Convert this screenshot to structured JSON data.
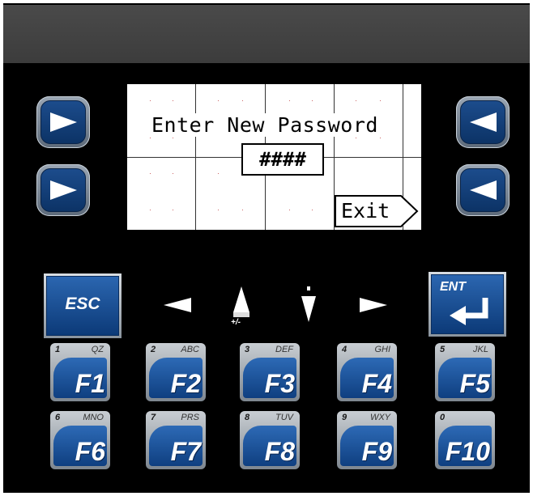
{
  "screen": {
    "title": "Enter New Password",
    "password_value": "####",
    "exit_label": "Exit"
  },
  "keys": {
    "esc_label": "ESC",
    "ent_label": "ENT",
    "plus_minus": "+/-",
    "function_keys": [
      {
        "label": "F1",
        "num": "1",
        "letters": "QZ"
      },
      {
        "label": "F2",
        "num": "2",
        "letters": "ABC"
      },
      {
        "label": "F3",
        "num": "3",
        "letters": "DEF"
      },
      {
        "label": "F4",
        "num": "4",
        "letters": "GHI"
      },
      {
        "label": "F5",
        "num": "5",
        "letters": "JKL"
      },
      {
        "label": "F6",
        "num": "6",
        "letters": "MNO"
      },
      {
        "label": "F7",
        "num": "7",
        "letters": "PRS"
      },
      {
        "label": "F8",
        "num": "8",
        "letters": "TUV"
      },
      {
        "label": "F9",
        "num": "9",
        "letters": "WXY"
      },
      {
        "label": "F10",
        "num": "0",
        "letters": ""
      }
    ]
  },
  "colors": {
    "key_blue": "#1c4c8c",
    "lcd_bg": "#ffffff",
    "panel_bg": "#000000",
    "title_bar": "#444444"
  },
  "icons": {
    "side_left": "right-pointer-icon",
    "side_right": "left-pointer-icon",
    "enter": "enter-arrow-icon"
  }
}
